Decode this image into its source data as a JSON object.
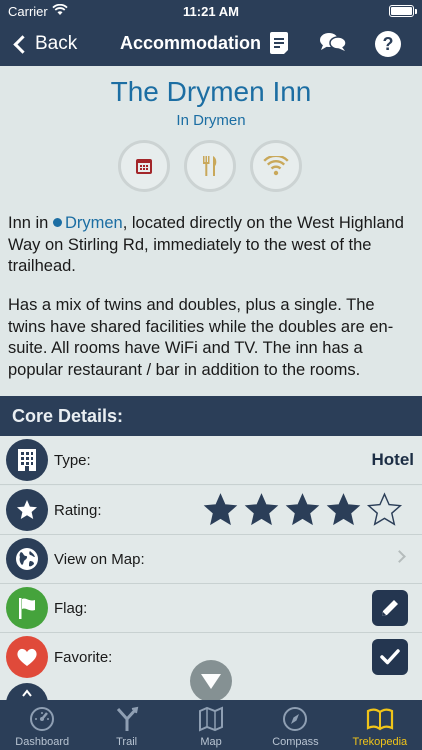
{
  "status": {
    "carrier": "Carrier",
    "time": "11:21 AM"
  },
  "nav": {
    "back_label": "Back",
    "title": "Accommodation"
  },
  "place": {
    "title": "The Drymen Inn",
    "subtitle": "In Drymen",
    "desc1_prefix": "Inn in ",
    "desc1_link": "Drymen",
    "desc1_rest": ", located directly on the West Highland Way on Stirling Rd, immediately to the west of the trailhead.",
    "desc2": "Has a mix of twins and doubles, plus a single. The twins have shared facilities while the doubles are en-suite. All rooms have WiFi and TV. The inn has a popular restaurant / bar in addition to the rooms.",
    "amenities": [
      "calendar-icon",
      "restaurant-icon",
      "wifi-icon"
    ]
  },
  "core": {
    "heading": "Core Details:",
    "type_label": "Type:",
    "type_value": "Hotel",
    "rating_label": "Rating:",
    "rating_value": 4,
    "rating_max": 5,
    "map_label": "View on Map:",
    "flag_label": "Flag:",
    "favorite_label": "Favorite:"
  },
  "tabs": [
    {
      "label": "Dashboard",
      "icon": "gauge-icon"
    },
    {
      "label": "Trail",
      "icon": "trail-icon"
    },
    {
      "label": "Map",
      "icon": "map-icon"
    },
    {
      "label": "Compass",
      "icon": "compass-icon"
    },
    {
      "label": "Trekopedia",
      "icon": "book-icon",
      "active": true
    }
  ],
  "colors": {
    "navy": "#2b3e58",
    "link": "#1c6ea3",
    "flag": "#45a33c",
    "favorite": "#e04a3a",
    "active_tab": "#f0c419"
  }
}
